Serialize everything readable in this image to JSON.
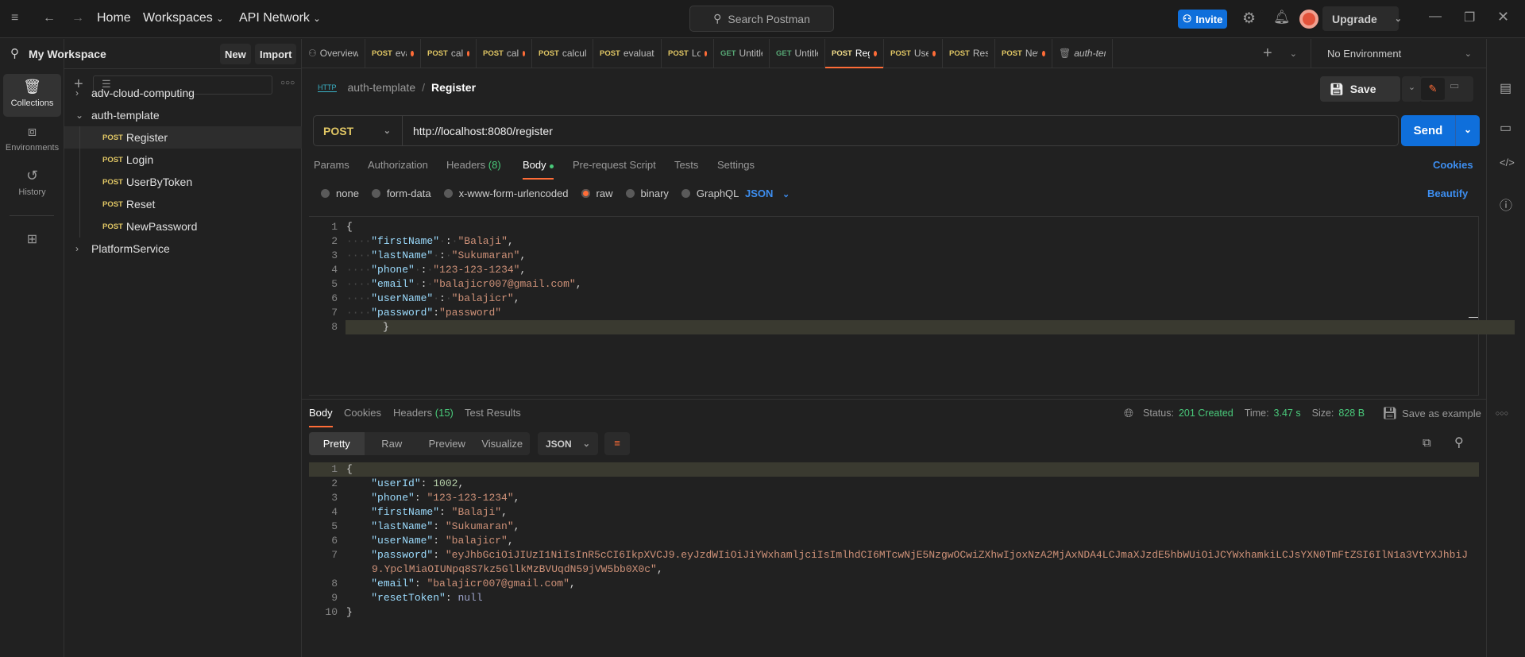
{
  "titlebar": {
    "home": "Home",
    "workspaces": "Workspaces",
    "api_network": "API Network",
    "search_placeholder": "Search Postman",
    "invite": "Invite",
    "upgrade": "Upgrade"
  },
  "sidebar": {
    "workspace": "My Workspace",
    "new": "New",
    "import": "Import",
    "rail": [
      {
        "label": "Collections",
        "icon": "collections-icon"
      },
      {
        "label": "Environments",
        "icon": "environments-icon"
      },
      {
        "label": "History",
        "icon": "history-icon"
      }
    ],
    "tree": [
      {
        "name": "adv-cloud-computing",
        "type": "folder",
        "open": false
      },
      {
        "name": "auth-template",
        "type": "folder",
        "open": true
      },
      {
        "method": "POST",
        "name": "Register",
        "selected": true
      },
      {
        "method": "POST",
        "name": "Login"
      },
      {
        "method": "POST",
        "name": "UserByToken"
      },
      {
        "method": "POST",
        "name": "Reset"
      },
      {
        "method": "POST",
        "name": "NewPassword"
      },
      {
        "name": "PlatformService",
        "type": "folder",
        "open": false
      }
    ]
  },
  "tabs": [
    {
      "method": "",
      "name": "Overview"
    },
    {
      "method": "POST",
      "name": "evalu",
      "dot": true
    },
    {
      "method": "POST",
      "name": "calcul",
      "dot": true
    },
    {
      "method": "POST",
      "name": "calcul",
      "dot": true
    },
    {
      "method": "POST",
      "name": "calcular"
    },
    {
      "method": "POST",
      "name": "evaluat"
    },
    {
      "method": "POST",
      "name": "Logi",
      "dot": true
    },
    {
      "method": "GET",
      "name": "Untitled"
    },
    {
      "method": "GET",
      "name": "Untitled"
    },
    {
      "method": "POST",
      "name": "Regis",
      "dot": true,
      "active": true
    },
    {
      "method": "POST",
      "name": "UserE",
      "dot": true
    },
    {
      "method": "POST",
      "name": "Reset"
    },
    {
      "method": "POST",
      "name": "NewF",
      "dot": true
    },
    {
      "method": "",
      "name": "auth-tem"
    }
  ],
  "environment": "No Environment",
  "breadcrumb": {
    "collection": "auth-template",
    "request": "Register"
  },
  "save": "Save",
  "request": {
    "method": "POST",
    "url": "http://localhost:8080/register",
    "send": "Send",
    "tabs": [
      "Params",
      "Authorization",
      "Headers",
      "Body",
      "Pre-request Script",
      "Tests",
      "Settings"
    ],
    "headers_count": "(8)",
    "cookies": "Cookies",
    "body_modes": [
      "none",
      "form-data",
      "x-www-form-urlencoded",
      "raw",
      "binary",
      "GraphQL"
    ],
    "selected_mode": "raw",
    "language": "JSON",
    "beautify": "Beautify",
    "body_lines": [
      [
        [
          "p",
          "{"
        ]
      ],
      [
        [
          "ws",
          "····"
        ],
        [
          "k",
          "\"firstName\""
        ],
        [
          "ws",
          "·"
        ],
        [
          "p",
          ":"
        ],
        [
          "ws",
          "·"
        ],
        [
          "s",
          "\"Balaji\""
        ],
        [
          "p",
          ","
        ]
      ],
      [
        [
          "ws",
          "····"
        ],
        [
          "k",
          "\"lastName\""
        ],
        [
          "ws",
          "·"
        ],
        [
          "p",
          ":"
        ],
        [
          "ws",
          "·"
        ],
        [
          "s",
          "\"Sukumaran\""
        ],
        [
          "p",
          ","
        ]
      ],
      [
        [
          "ws",
          "····"
        ],
        [
          "k",
          "\"phone\""
        ],
        [
          "ws",
          "·"
        ],
        [
          "p",
          ":"
        ],
        [
          "ws",
          "·"
        ],
        [
          "s",
          "\"123-123-1234\""
        ],
        [
          "p",
          ","
        ]
      ],
      [
        [
          "ws",
          "····"
        ],
        [
          "k",
          "\"email\""
        ],
        [
          "ws",
          "·"
        ],
        [
          "p",
          ":"
        ],
        [
          "ws",
          "·"
        ],
        [
          "s",
          "\"balajicr007@gmail.com\""
        ],
        [
          "p",
          ","
        ]
      ],
      [
        [
          "ws",
          "····"
        ],
        [
          "k",
          "\"userName\""
        ],
        [
          "ws",
          "·"
        ],
        [
          "p",
          ":"
        ],
        [
          "ws",
          "·"
        ],
        [
          "s",
          "\"balajicr\""
        ],
        [
          "p",
          ","
        ]
      ],
      [
        [
          "ws",
          "····"
        ],
        [
          "k",
          "\"password\""
        ],
        [
          "p",
          ":"
        ],
        [
          "s",
          "\"password\""
        ]
      ],
      [
        [
          "p",
          "}"
        ]
      ]
    ]
  },
  "response": {
    "tabs": [
      "Body",
      "Cookies",
      "Headers",
      "Test Results"
    ],
    "headers_count": "(15)",
    "status_label": "Status:",
    "status": "201 Created",
    "time_label": "Time:",
    "time": "3.47 s",
    "size_label": "Size:",
    "size": "828 B",
    "save_example": "Save as example",
    "views": [
      "Pretty",
      "Raw",
      "Preview",
      "Visualize"
    ],
    "format": "JSON",
    "lines": [
      [
        [
          "p",
          "{"
        ]
      ],
      [
        [
          "p",
          "    "
        ],
        [
          "k",
          "\"userId\""
        ],
        [
          "p",
          ": "
        ],
        [
          "n",
          "1002"
        ],
        [
          "p",
          ","
        ]
      ],
      [
        [
          "p",
          "    "
        ],
        [
          "k",
          "\"phone\""
        ],
        [
          "p",
          ": "
        ],
        [
          "s",
          "\"123-123-1234\""
        ],
        [
          "p",
          ","
        ]
      ],
      [
        [
          "p",
          "    "
        ],
        [
          "k",
          "\"firstName\""
        ],
        [
          "p",
          ": "
        ],
        [
          "s",
          "\"Balaji\""
        ],
        [
          "p",
          ","
        ]
      ],
      [
        [
          "p",
          "    "
        ],
        [
          "k",
          "\"lastName\""
        ],
        [
          "p",
          ": "
        ],
        [
          "s",
          "\"Sukumaran\""
        ],
        [
          "p",
          ","
        ]
      ],
      [
        [
          "p",
          "    "
        ],
        [
          "k",
          "\"userName\""
        ],
        [
          "p",
          ": "
        ],
        [
          "s",
          "\"balajicr\""
        ],
        [
          "p",
          ","
        ]
      ],
      [
        [
          "p",
          "    "
        ],
        [
          "k",
          "\"password\""
        ],
        [
          "p",
          ": "
        ],
        [
          "s",
          "\"eyJhbGciOiJIUzI1NiIsInR5cCI6IkpXVCJ9.eyJzdWIiOiJiYWxhamljciIsImlhdCI6MTcwNjE5NzgwOCwiZXhwIjoxNzA2MjAxNDA4LCJmaXJzdE5hbWUiOiJCYWxhamkiLCJsYXN0TmFtZSI6IlN1a3VtYXJhbiJ9.YpclMiaOIUNpq8S7kz5GllkMzBVUqdN59jVW5bb0X0c\""
        ],
        [
          "p",
          ","
        ]
      ],
      [
        [
          "p",
          "    "
        ],
        [
          "k",
          "\"email\""
        ],
        [
          "p",
          ": "
        ],
        [
          "s",
          "\"balajicr007@gmail.com\""
        ],
        [
          "p",
          ","
        ]
      ],
      [
        [
          "p",
          "    "
        ],
        [
          "k",
          "\"resetToken\""
        ],
        [
          "p",
          ": "
        ],
        [
          "nl",
          "null"
        ]
      ],
      [
        [
          "p",
          "}"
        ]
      ]
    ]
  },
  "colors": {
    "accent": "#ff6c37",
    "primary": "#0f6fdb",
    "post": "#e0c664",
    "get": "#57a875",
    "success": "#49c97a"
  }
}
